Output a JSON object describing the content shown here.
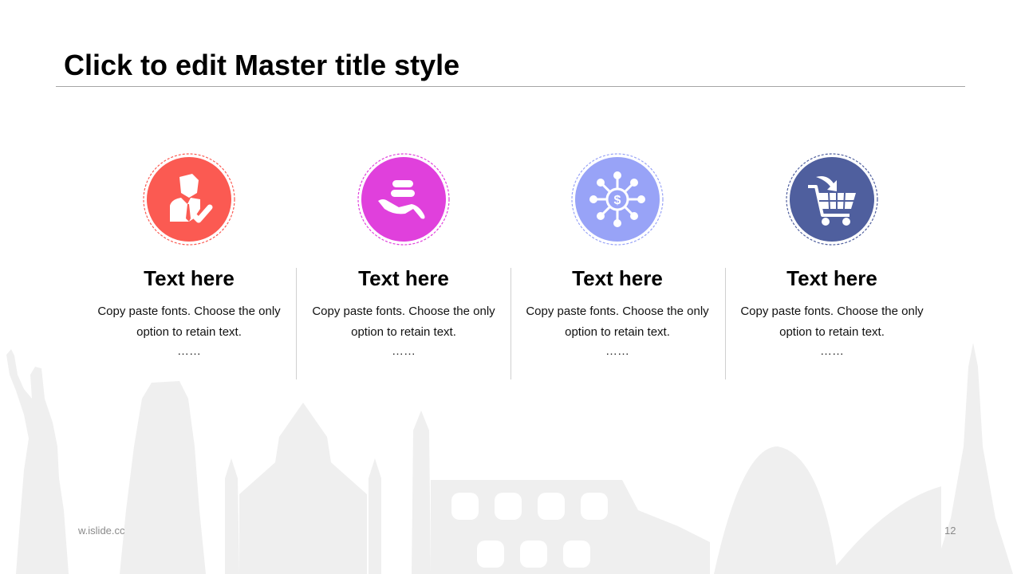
{
  "slide": {
    "title": "Click to edit Master title style",
    "footer_url": "w.islide.cc",
    "page_number": "12"
  },
  "colors": {
    "card1": "#fb5a52",
    "card2": "#e040dc",
    "card3": "#98a3f7",
    "card4": "#4f5f9e",
    "skyline": "#efefef"
  },
  "cards": [
    {
      "icon": "businessman-check-icon",
      "title": "Text here",
      "line1": "Copy paste fonts. Choose the only",
      "line2": "option to retain text.",
      "dots": "……"
    },
    {
      "icon": "hand-coins-icon",
      "title": "Text here",
      "line1": "Copy paste fonts. Choose the only",
      "line2": "option to retain text.",
      "dots": "……"
    },
    {
      "icon": "dollar-network-icon",
      "title": "Text here",
      "line1": "Copy paste fonts. Choose the only",
      "line2": "option to retain text.",
      "dots": "……"
    },
    {
      "icon": "shopping-cart-icon",
      "title": "Text here",
      "line1": "Copy paste fonts. Choose the only",
      "line2": "option to retain text.",
      "dots": "……"
    }
  ]
}
